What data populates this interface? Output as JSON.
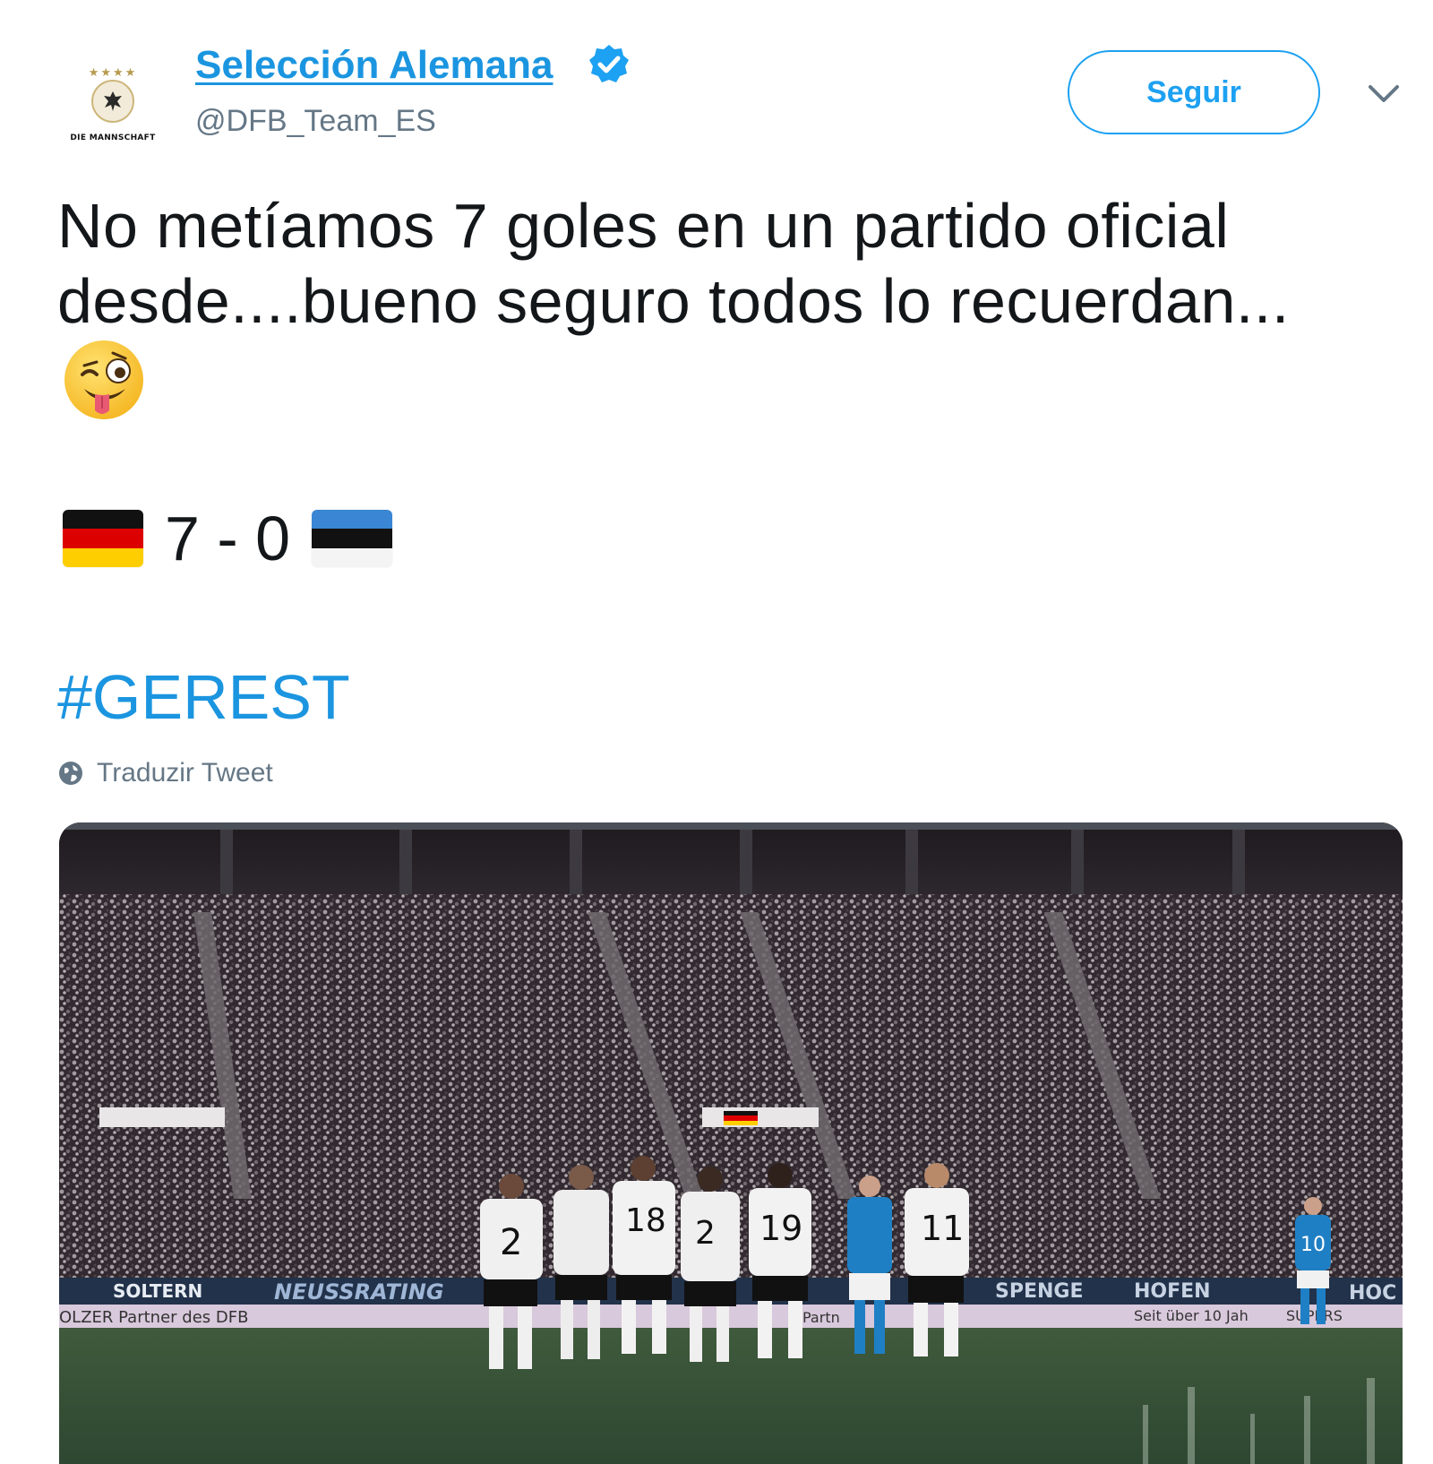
{
  "tweet": {
    "author": {
      "name": "Selección Alemana",
      "handle": "@DFB_Team_ES",
      "avatar_text": "DIE MANNSCHAFT",
      "avatar_stars": "★★★★",
      "verified_icon": "verified-badge-icon"
    },
    "follow_label": "Seguir",
    "menu_icon": "chevron-down-icon",
    "text_lines": [
      "No metíamos 7 goles en un partido oficial",
      "desde....bueno seguro todos lo recuerdan..."
    ],
    "emoji": "winking-face-with-tongue",
    "score": {
      "home_flag": "germany-flag",
      "text": "7 - 0",
      "away_flag": "estonia-flag"
    },
    "hashtag": "#GEREST",
    "translate_label": "Traduzir Tweet",
    "media": {
      "description_icon": "stadium-photo",
      "ad_boards": {
        "left_1": "SOLTERN",
        "left_2": "NEUSSRATING",
        "left_3": "OLZER Partner des DFB",
        "right_1": "SPENGE",
        "right_2": "HOFEN",
        "right_3": "Seit über 10 Jah",
        "right_4": "SUPERS",
        "right_5": "HOC",
        "mid": "Partn"
      },
      "jersey_numbers": [
        "2",
        "18",
        "2",
        "19",
        "11",
        "10"
      ]
    }
  },
  "colors": {
    "brand_blue": "#1da1f2",
    "link_blue": "#1b95e0",
    "text": "#14171a",
    "muted": "#657786"
  }
}
